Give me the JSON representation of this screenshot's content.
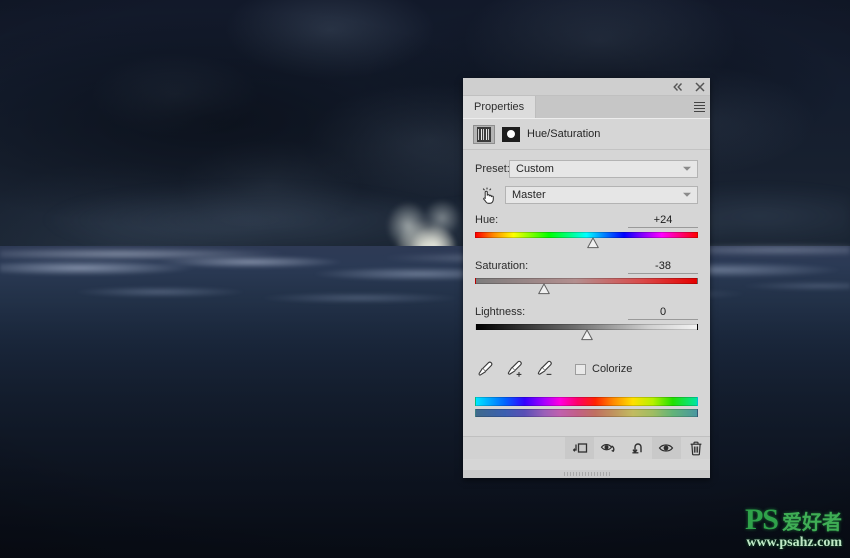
{
  "app": {
    "panel_title": "Properties",
    "adjustment_title": "Hue/Saturation"
  },
  "titlebar": {
    "collapse_label": "«",
    "close_label": "×",
    "collapse_icon": "double-chevron-left-icon",
    "close_icon": "close-icon"
  },
  "tabs": [
    {
      "label": "Properties",
      "active": true
    }
  ],
  "panel_menu": {
    "icon": "hamburger-menu-icon"
  },
  "header_icons": {
    "adjustment_icon": "adjustment-properties-icon",
    "mask_icon": "layer-mask-icon"
  },
  "preset": {
    "label": "Preset:",
    "value": "Custom",
    "caret_icon": "chevron-down-icon"
  },
  "channel": {
    "value": "Master",
    "caret_icon": "chevron-down-icon",
    "on_image_icon": "on-image-adjustment-hand-icon"
  },
  "sliders": [
    {
      "name": "Hue:",
      "value": "+24",
      "pos_pct": 53,
      "track": "hue"
    },
    {
      "name": "Saturation:",
      "value": "-38",
      "pos_pct": 31,
      "track": "sat"
    },
    {
      "name": "Lightness:",
      "value": "0",
      "pos_pct": 50,
      "track": "light"
    }
  ],
  "tools": {
    "eyedropper": "eyedropper-icon",
    "eyedropper_add": "eyedropper-add-icon",
    "eyedropper_subtract": "eyedropper-subtract-icon",
    "colorize_label": "Colorize",
    "colorize_checked": false
  },
  "spectrum": {
    "top_bar": "hue-spectrum-bar",
    "bottom_bar": "hue-result-spectrum-bar"
  },
  "footer_buttons": [
    {
      "name": "clip-to-layer-button",
      "icon": "clip-to-layer-icon"
    },
    {
      "name": "view-previous-state-button",
      "icon": "eye-previous-state-icon"
    },
    {
      "name": "reset-adjustment-button",
      "icon": "reset-arrow-icon"
    },
    {
      "name": "toggle-visibility-button",
      "icon": "eye-icon"
    },
    {
      "name": "delete-adjustment-button",
      "icon": "trash-icon"
    }
  ],
  "watermark": {
    "ps": "PS",
    "cn": "爱好者",
    "url": "www.psahz.com"
  },
  "colors": {
    "panel_bg": "#d6d6d6",
    "panel_tab_bg": "#c6c6c6",
    "text": "#2b2b2b",
    "sea_dark": "#101827",
    "sky_dark": "#12192a",
    "watermark_green": "#2fa24a"
  }
}
